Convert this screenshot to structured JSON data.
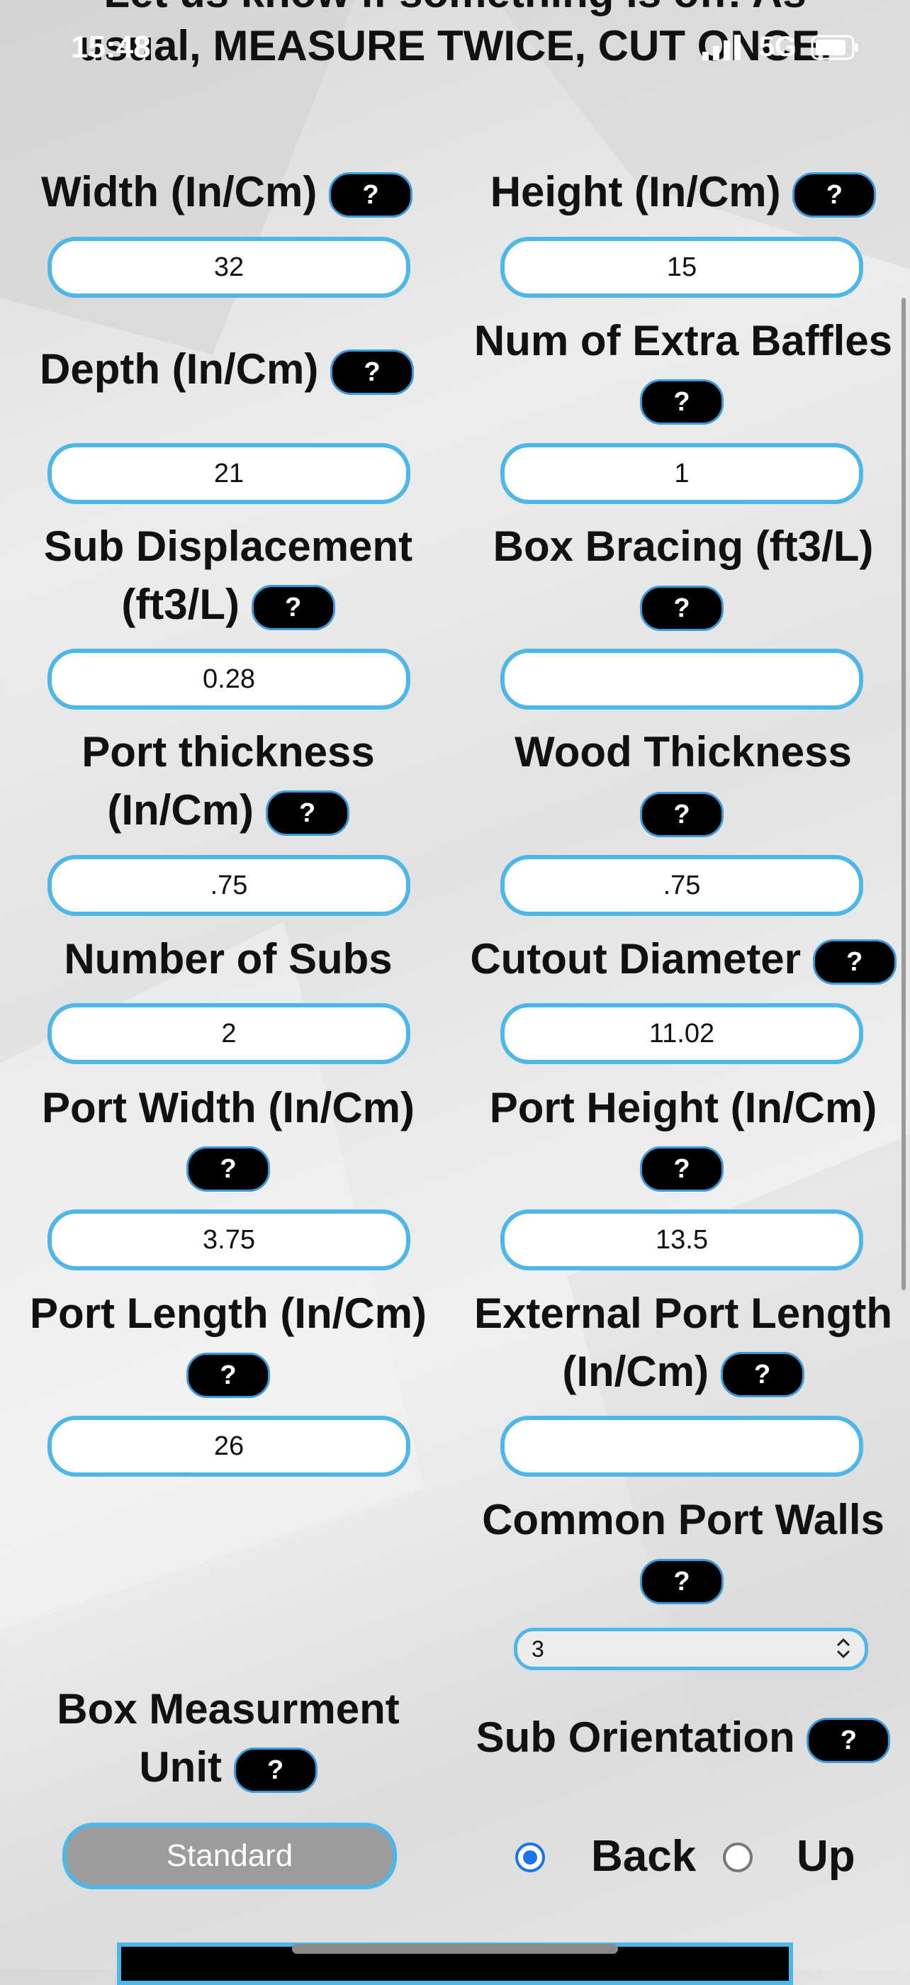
{
  "status_bar": {
    "time": "15:48",
    "network": "5G"
  },
  "banner": {
    "partial_line": "Let us know if something is off! As",
    "line": "usual, MEASURE TWICE, CUT ONCE."
  },
  "help_label": "?",
  "fields": {
    "width": {
      "label": "Width (In/Cm)",
      "value": "32"
    },
    "height": {
      "label": "Height (In/Cm)",
      "value": "15"
    },
    "depth": {
      "label": "Depth (In/Cm)",
      "value": "21"
    },
    "extra_baffles": {
      "label": "Num of Extra Baffles",
      "value": "1"
    },
    "sub_displacement": {
      "label_line1": "Sub Displacement",
      "label_line2": "(ft3/L)",
      "value": "0.28"
    },
    "box_bracing": {
      "label": "Box Bracing (ft3/L)",
      "value": ""
    },
    "port_thickness": {
      "label_line1": "Port thickness",
      "label_line2": "(In/Cm)",
      "value": ".75"
    },
    "wood_thickness": {
      "label": "Wood Thickness",
      "value": ".75"
    },
    "num_subs": {
      "label": "Number of Subs",
      "value": "2"
    },
    "cutout_diameter": {
      "label": "Cutout Diameter",
      "value": "11.02"
    },
    "port_width": {
      "label": "Port Width (In/Cm)",
      "value": "3.75"
    },
    "port_height": {
      "label": "Port Height (In/Cm)",
      "value": "13.5"
    },
    "port_length": {
      "label": "Port Length (In/Cm)",
      "value": "26"
    },
    "external_port_length": {
      "label_line1": "External Port Length",
      "label_line2": "(In/Cm)",
      "value": ""
    }
  },
  "common_port_walls": {
    "label": "Common Port Walls",
    "selected": "3",
    "options": [
      "3"
    ]
  },
  "box_unit": {
    "label_line1": "Box Measurment",
    "label_line2": "Unit",
    "button": "Standard"
  },
  "sub_orientation": {
    "label": "Sub Orientation",
    "options": [
      {
        "label": "Back",
        "selected": true
      },
      {
        "label": "Up",
        "selected": false
      }
    ]
  }
}
